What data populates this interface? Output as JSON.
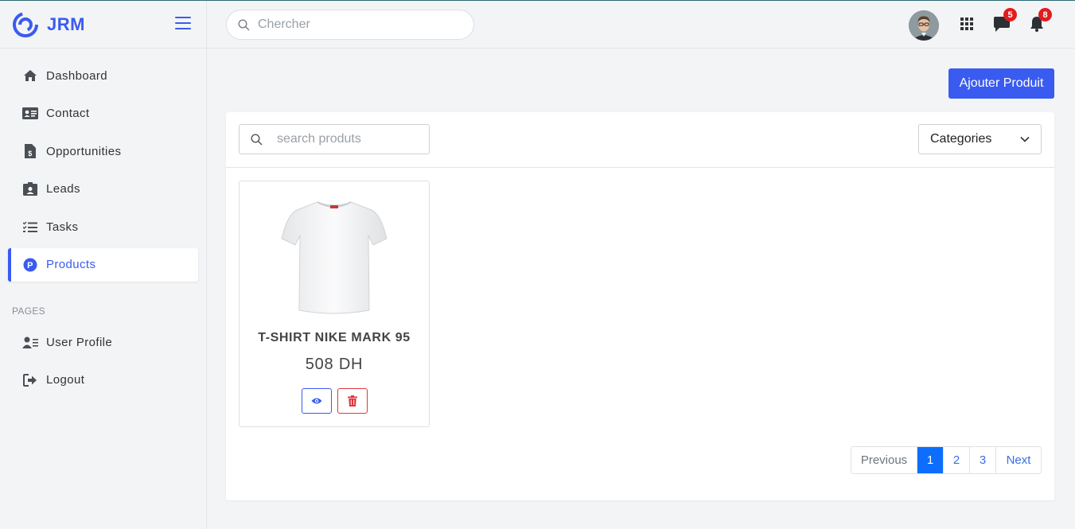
{
  "brand": {
    "name": "JRM"
  },
  "sidebar": {
    "items": [
      {
        "label": "Dashboard",
        "icon": "home-icon"
      },
      {
        "label": "Contact",
        "icon": "id-card-icon"
      },
      {
        "label": "Opportunities",
        "icon": "invoice-dollar-icon"
      },
      {
        "label": "Leads",
        "icon": "id-badge-icon"
      },
      {
        "label": "Tasks",
        "icon": "tasks-icon"
      },
      {
        "label": "Products",
        "icon": "product-p-icon",
        "active": true
      }
    ],
    "section_label": "PAGES",
    "pages": [
      {
        "label": "User Profile",
        "icon": "user-profile-icon"
      },
      {
        "label": "Logout",
        "icon": "logout-icon"
      }
    ]
  },
  "topbar": {
    "search_placeholder": "Chercher",
    "messages_count": "5",
    "notifications_count": "8"
  },
  "main": {
    "add_button": "Ajouter Produit",
    "search_placeholder": "search produts",
    "category_select": "Categories",
    "products": [
      {
        "name": "T-SHIRT NIKE MARK 95",
        "price": "508 DH",
        "image": "white-tshirt"
      }
    ],
    "pagination": {
      "previous": "Previous",
      "pages": [
        "1",
        "2",
        "3"
      ],
      "current": "1",
      "next": "Next"
    }
  },
  "colors": {
    "accent": "#3a5bf0",
    "danger": "#e0353a",
    "badge": "#e11d1d",
    "page_active": "#0d6efd"
  }
}
